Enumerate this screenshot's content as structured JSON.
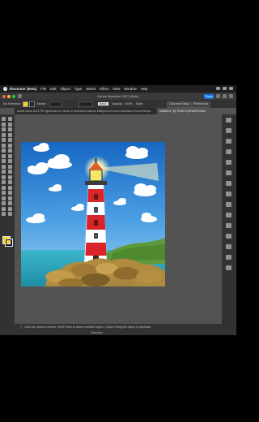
{
  "menubar": {
    "items": [
      "Illustrator (Beta)",
      "File",
      "Edit",
      "Object",
      "Type",
      "Select",
      "Effect",
      "View",
      "Window",
      "Help"
    ]
  },
  "titlebar": {
    "title": "Adobe Illustrator 2023 (Beta)",
    "share_label": "Share"
  },
  "control_bar": {
    "selection_label": "No Selection",
    "stroke_label": "Stroke:",
    "style_label": "Basic",
    "opacity_label": "Opacity:",
    "opacity_value": "100%",
    "style_label_2": "Style:",
    "document_setup_label": "Document Setup",
    "preferences_label": "Preferences",
    "fill_color": "#f3d61b",
    "stroke_color": "#111111"
  },
  "tabs": {
    "inactive": "adobe-stock-2023-Fthi lighthouse on ocean or sea beach cartoon background vector illustration [Converted].ai",
    "active": "Untitled-1* @ 75.68 % (RGB/Preview)"
  },
  "status": {
    "hint": "Click the object to select  |  Shift+Click to select multiple object  |  Option+Drag the object to duplicate",
    "zoom_label": "Selection"
  },
  "tools": [
    "selection-tool-icon",
    "direct-selection-tool-icon",
    "magic-wand-icon",
    "lasso-icon",
    "pen-tool-icon",
    "curvature-icon",
    "type-tool-icon",
    "touch-type-icon",
    "line-tool-icon",
    "arc-icon",
    "rectangle-tool-icon",
    "ellipse-icon",
    "paintbrush-icon",
    "blob-brush-icon",
    "pencil-icon",
    "shaper-icon",
    "eraser-icon",
    "scissors-icon",
    "rotate-icon",
    "reflect-icon",
    "scale-icon",
    "width-icon",
    "free-transform-icon",
    "puppet-warp-icon",
    "shape-builder-icon",
    "live-paint-icon",
    "perspective-icon",
    "mesh-icon",
    "gradient-icon",
    "eyedropper-icon",
    "blend-icon",
    "symbol-sprayer-icon",
    "graph-icon",
    "artboard-tool-icon",
    "slice-icon",
    "hand-tool-icon",
    "zoom-tool-icon",
    "edit-toolbar-icon"
  ],
  "panel_icons": [
    "properties-icon",
    "layers-icon",
    "libraries-icon",
    "color-icon",
    "swatches-icon",
    "brushes-icon",
    "symbols-icon",
    "stroke-icon",
    "gradient-panel-icon",
    "transparency-icon",
    "appearance-icon",
    "graphic-styles-icon",
    "align-icon",
    "pathfinder-icon",
    "transform-icon"
  ]
}
